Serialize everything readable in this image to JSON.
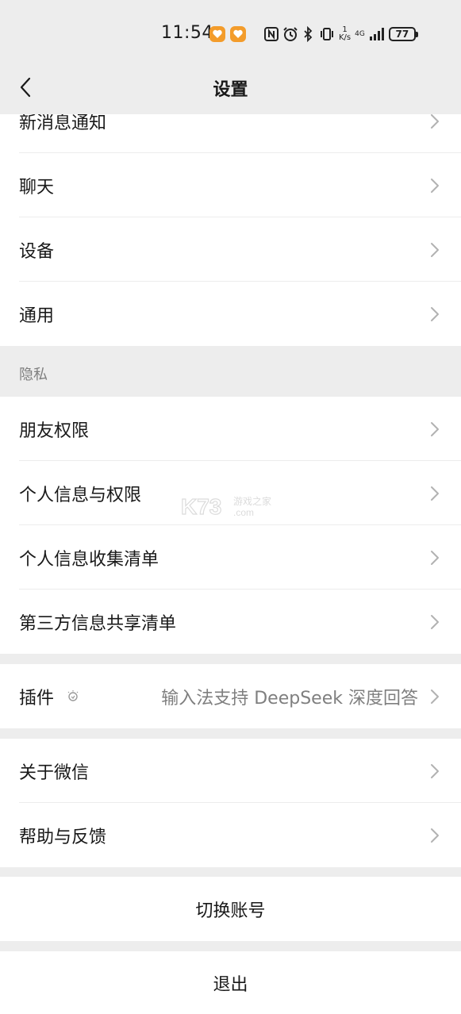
{
  "status_bar": {
    "time": "11:54",
    "net_speed_value": "1",
    "net_speed_unit": "K/s",
    "network_type": "4G",
    "battery": "77"
  },
  "nav": {
    "title": "设置"
  },
  "groups": {
    "top": [
      "新消息通知",
      "聊天",
      "设备",
      "通用"
    ],
    "privacy_header": "隐私",
    "privacy": [
      "朋友权限",
      "个人信息与权限",
      "个人信息收集清单",
      "第三方信息共享清单"
    ],
    "plugin": {
      "label": "插件",
      "value": "输入法支持 DeepSeek 深度回答"
    },
    "about": [
      "关于微信",
      "帮助与反馈"
    ]
  },
  "actions": {
    "switch_account": "切换账号",
    "logout": "退出"
  },
  "watermark": {
    "brand": "K73",
    "text_cn": "游戏之家",
    "text_en": ".com"
  }
}
